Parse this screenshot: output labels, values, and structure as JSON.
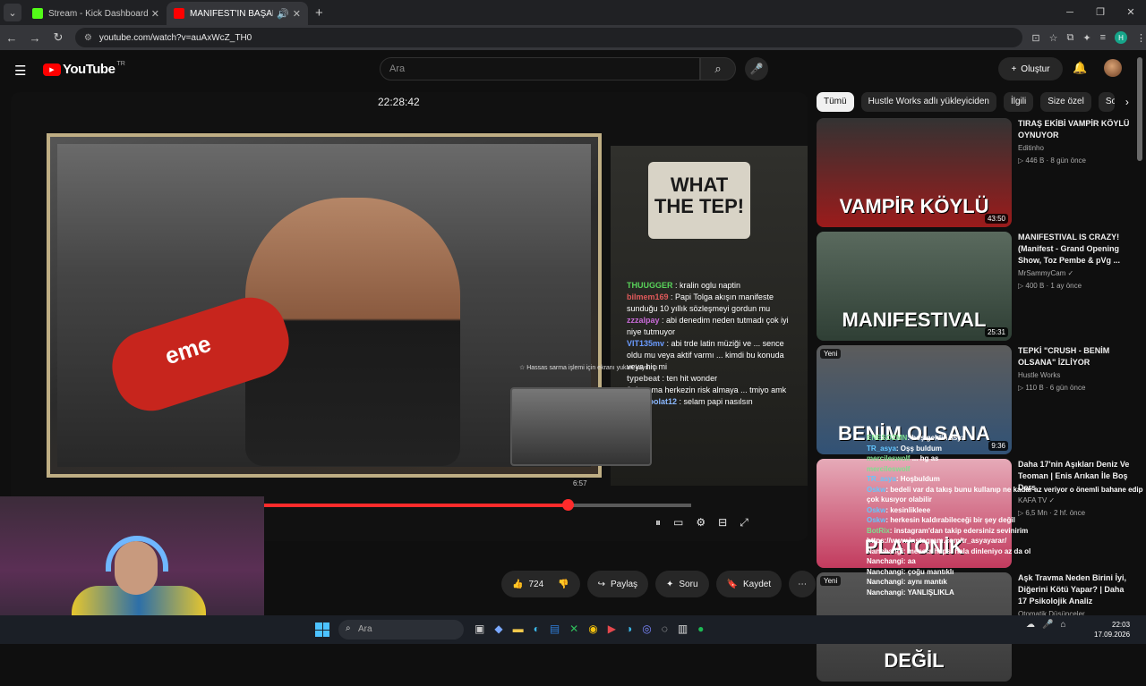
{
  "browser": {
    "tabs": [
      {
        "label": "Stream - Kick Dashboard",
        "favicon_color": "#53fc18",
        "active": false
      },
      {
        "label": "MANİFEST'İN BAŞARISININ",
        "favicon_color": "#ff0000",
        "active": true
      }
    ],
    "new_tab": "+",
    "url": "youtube.com/watch?v=auAxWcZ_TH0",
    "profile_initial": "H",
    "window_controls": [
      "─",
      "❐",
      "✕"
    ]
  },
  "youtube": {
    "logo_word": "YouTube",
    "region": "TR",
    "search_placeholder": "Ara",
    "create_label": "Oluştur"
  },
  "player": {
    "clock": "22:28:42",
    "art_text": "WHAT THE TEP!",
    "mic_label": "eme",
    "hint": "☆ Hassas sarma işlemi için ekranı yukarı kaydırın",
    "mini_time": "6:57",
    "progress_fraction": 0.71,
    "overlay_chat": [
      {
        "user": "THUUGGER",
        "text": ": kralin oglu naptin",
        "color": "#58d35a"
      },
      {
        "user": "bilmem169",
        "text": ": Papi Tolga akışın manifeste sunduğu 10 yıllık sözleşmeyi gordun mu",
        "color": "#e05a5a"
      },
      {
        "user": "zzzalpay",
        "text": ": abi denedim neden tutmadı çok iyi niye tutmuyor",
        "color": "#c96bd8"
      },
      {
        "user": "VIT135mv",
        "text": ": abi trde latin müziği ve ... sence oldu mu veya aktif varmı ... kimdi bu konuda veya hiç mi",
        "color": "#6b9cff"
      },
      {
        "user": "typebeat",
        "text": ": ten hit wonder",
        "color": "#c7c7c7"
      },
      {
        "user": "3sk",
        "text": ": ama herkezin risk almaya ... tmiyo amk",
        "color": "#c7c7c7"
      },
      {
        "user": "emirpoolat12",
        "text": ": selam papi nasılsın",
        "color": "#8bb8ff"
      }
    ]
  },
  "actions": {
    "likes": "724",
    "share": "Paylaş",
    "ask": "Soru",
    "save": "Kaydet",
    "more": "⋯"
  },
  "chips": [
    "Tümü",
    "Hustle Works adlı yükleyiciden",
    "İlgili",
    "Size özel",
    "So"
  ],
  "recommendations": [
    {
      "title": "TIRAŞ EKİBİ VAMPİR KÖYLÜ OYNUYOR",
      "channel": "Editinho",
      "meta": "▷ 446 B · 8 gün önce",
      "duration": "43:50",
      "badge": "",
      "thumb_text": "VAMPİR KÖYLÜ",
      "thumb_color": "#9b1b1b"
    },
    {
      "title": "MANIFESTIVAL IS CRAZY! (Manifest - Grand Opening Show, Toz Pembe & pVg ...",
      "channel": "MrSammyCam ✓",
      "meta": "▷ 400 B · 1 ay önce",
      "duration": "25:31",
      "badge": "",
      "thumb_text": "MANIFESTIVAL",
      "thumb_color": "#2f3f35"
    },
    {
      "title": "TEPKİ \"CRUSH - BENİM OLSANA\" İZLİYOR",
      "channel": "Hustle Works",
      "meta": "▷ 110 B · 6 gün önce",
      "duration": "9:36",
      "badge": "Yeni",
      "thumb_text": "BENİM OLSANA",
      "thumb_color": "#315276"
    },
    {
      "title": "Daha 17'nin Aşıkları Deniz Ve Teoman | Enis Arıkan İle Boş Ders",
      "channel": "KAFA TV ✓",
      "meta": "▷ 6,5 Mn · 2 hf. önce",
      "duration": "",
      "badge": "",
      "thumb_text": "PLATONİK",
      "thumb_color": "#c23b5e"
    },
    {
      "title": "Aşk Travma Neden Birini İyi, Diğerini Kötü Yapar? | Daha 17 Psikolojik Analiz",
      "channel": "Otomatik Düşünceler",
      "meta": "",
      "duration": "",
      "badge": "Yeni",
      "thumb_text": "DEĞİL",
      "thumb_color": "#3a3a3a"
    }
  ],
  "chat_overlay": [
    {
      "user": "ENESOZMN",
      "text": ": hoş geldin asya"
    },
    {
      "user": "TR_asya",
      "text": ": Oşş buldum"
    },
    {
      "user": "mercileswolf",
      "text": " ... hg as"
    },
    {
      "user": "mercileswolf",
      "text": ""
    },
    {
      "user": "TR_asya",
      "text": ": Hoşbuldum"
    },
    {
      "user": "Oskw",
      "text": ": bedeli var da takış bunu kullanıp ne kadar az veriyor o önemli bahane edip çok kusıyor olabilir"
    },
    {
      "user": "Oskw",
      "text": ": kesinlikleee"
    },
    {
      "user": "Oskw",
      "text": ": herkesin kaldırabileceği bir şey değil"
    },
    {
      "user": "BotRix",
      "text": ": instagram'dan takip edersiniz sevinirim https://www.instagram.com/tr_asyayarar/"
    },
    {
      "user": "Nanchangi",
      "text": ": mesela hepsi hala dinleniyo az da ol"
    },
    {
      "user": "Nanchangi",
      "text": ": aa"
    },
    {
      "user": "Nanchangi",
      "text": ": çoğu mantıklı"
    },
    {
      "user": "Nanchangi",
      "text": ": aynı mantık"
    },
    {
      "user": "Nanchangi",
      "text": ": YANLIŞLIKLA"
    }
  ],
  "taskbar": {
    "search_placeholder": "Ara",
    "time": "22:03",
    "date": "17.09.2026"
  }
}
